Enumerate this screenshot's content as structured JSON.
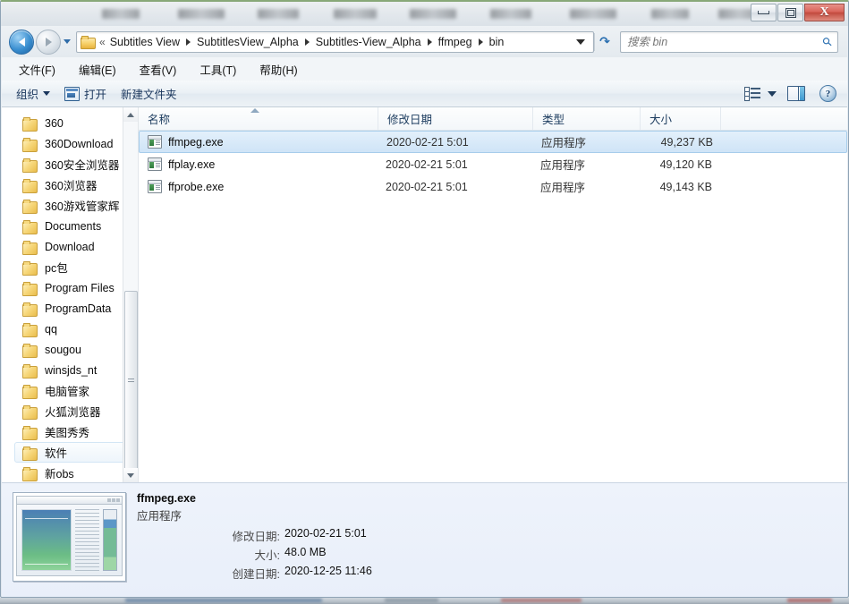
{
  "window": {
    "title_blurred": true,
    "buttons": {
      "minimize": "minimize",
      "restore": "restore",
      "close": "X"
    }
  },
  "address": {
    "back_tooltip": "后退",
    "forward_tooltip": "前进",
    "chevron": "«",
    "crumbs": [
      "Subtitles View",
      "SubtitlesView_Alpha",
      "Subtitles-View_Alpha",
      "ffmpeg",
      "bin"
    ],
    "refresh_icon": "refresh-icon"
  },
  "search": {
    "placeholder": "搜索 bin",
    "value": ""
  },
  "menu": {
    "items": [
      {
        "label": "文件(F)",
        "text": "文件",
        "key": "F"
      },
      {
        "label": "编辑(E)",
        "text": "编辑",
        "key": "E"
      },
      {
        "label": "查看(V)",
        "text": "查看",
        "key": "V"
      },
      {
        "label": "工具(T)",
        "text": "工具",
        "key": "T"
      },
      {
        "label": "帮助(H)",
        "text": "帮助",
        "key": "H"
      }
    ]
  },
  "toolbar": {
    "organize_label": "组织",
    "open_label": "打开",
    "new_folder_label": "新建文件夹",
    "view_options_icon": "view-options-icon",
    "preview_pane_icon": "preview-pane-icon",
    "help_icon": "?"
  },
  "sidebar": {
    "items": [
      {
        "label": "360"
      },
      {
        "label": "360Download"
      },
      {
        "label": "360安全浏览器"
      },
      {
        "label": "360浏览器"
      },
      {
        "label": "360游戏管家辉"
      },
      {
        "label": "Documents"
      },
      {
        "label": "Download"
      },
      {
        "label": "pc包"
      },
      {
        "label": "Program Files"
      },
      {
        "label": "ProgramData"
      },
      {
        "label": "qq"
      },
      {
        "label": "sougou"
      },
      {
        "label": "winsjds_nt"
      },
      {
        "label": "电脑管家"
      },
      {
        "label": "火狐浏览器"
      },
      {
        "label": "美图秀秀"
      },
      {
        "label": "软件",
        "hovered": true
      },
      {
        "label": "新obs"
      }
    ]
  },
  "filelist": {
    "columns": [
      {
        "label": "名称",
        "sorted": "asc"
      },
      {
        "label": "修改日期"
      },
      {
        "label": "类型"
      },
      {
        "label": "大小"
      }
    ],
    "rows": [
      {
        "name": "ffmpeg.exe",
        "date": "2020-02-21 5:01",
        "type": "应用程序",
        "size": "49,237 KB",
        "selected": true
      },
      {
        "name": "ffplay.exe",
        "date": "2020-02-21 5:01",
        "type": "应用程序",
        "size": "49,120 KB",
        "selected": false
      },
      {
        "name": "ffprobe.exe",
        "date": "2020-02-21 5:01",
        "type": "应用程序",
        "size": "49,143 KB",
        "selected": false
      }
    ]
  },
  "details": {
    "file_name": "ffmpeg.exe",
    "file_type": "应用程序",
    "fields": [
      {
        "label": "修改日期:",
        "value": "2020-02-21 5:01"
      },
      {
        "label": "大小:",
        "value": "48.0 MB"
      },
      {
        "label": "创建日期:",
        "value": "2020-12-25 11:46"
      }
    ]
  },
  "colors": {
    "selection_blue": "#cfe4f7",
    "selection_border": "#a7cdeb",
    "header_text": "#1b3b5e",
    "close_button_red": "#c24a3e",
    "details_background": "#eef3fb",
    "folder_yellow": "#f7d87c"
  }
}
